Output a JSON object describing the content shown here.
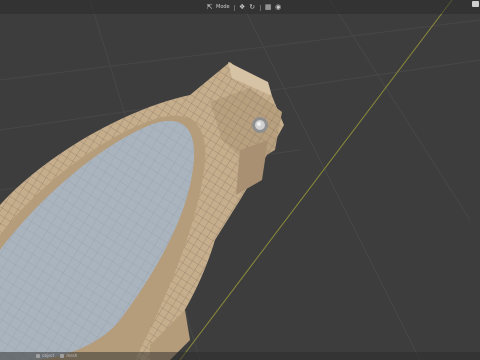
{
  "viewport": {
    "background": "#3d3d3d",
    "grid_color": "#474747",
    "axis_color": "#8a8a3a",
    "model": {
      "name": "glasses-frame",
      "frame_color": "#c6ae8d",
      "lens_color": "#aab4be",
      "wire_color": "#7d6c57"
    }
  },
  "header": {
    "mode_label": "Mode",
    "icons": [
      "cursor-icon",
      "move-icon",
      "local-icon",
      "snap-icon",
      "proportional-icon"
    ]
  },
  "footer": {
    "items": [
      {
        "icon": "object-icon",
        "label": "object"
      },
      {
        "icon": "mesh-icon",
        "label": "mesh"
      }
    ]
  }
}
